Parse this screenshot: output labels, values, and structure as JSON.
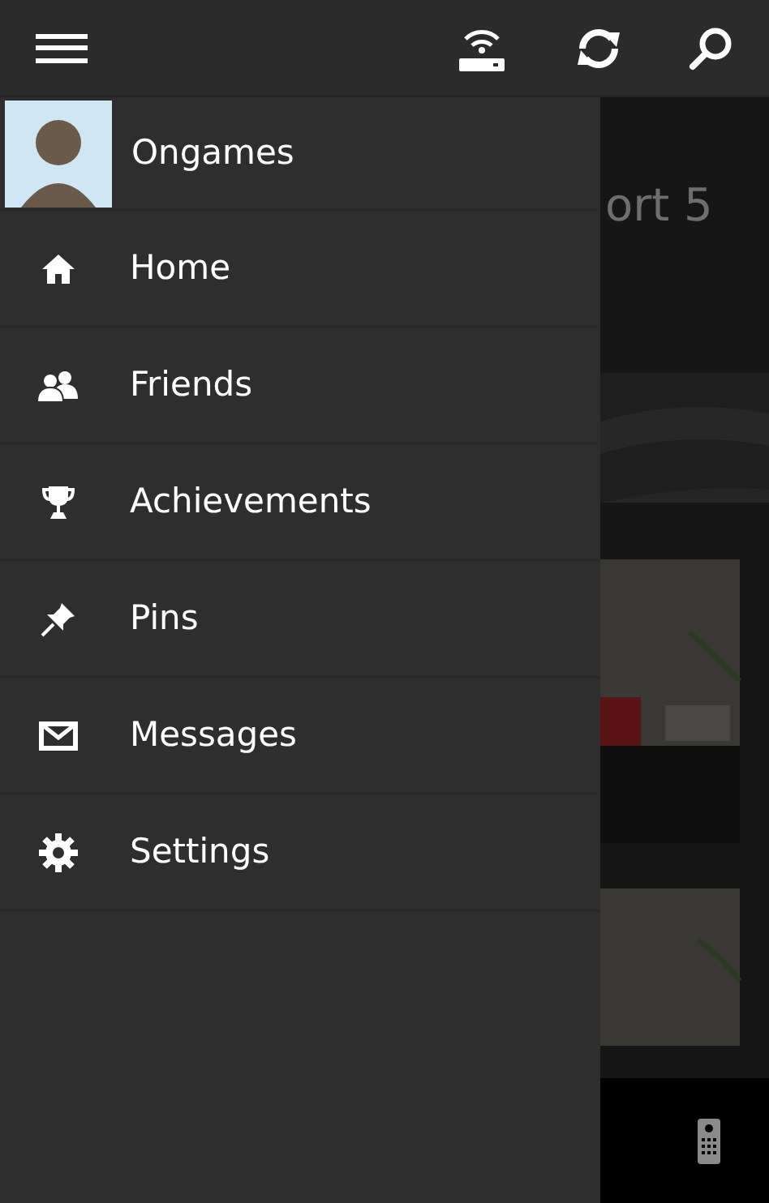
{
  "profile": {
    "name": "Ongames"
  },
  "menu": [
    {
      "label": "Home"
    },
    {
      "label": "Friends"
    },
    {
      "label": "Achievements"
    },
    {
      "label": "Pins"
    },
    {
      "label": "Messages"
    },
    {
      "label": "Settings"
    }
  ],
  "background": {
    "title": "ort 5"
  }
}
